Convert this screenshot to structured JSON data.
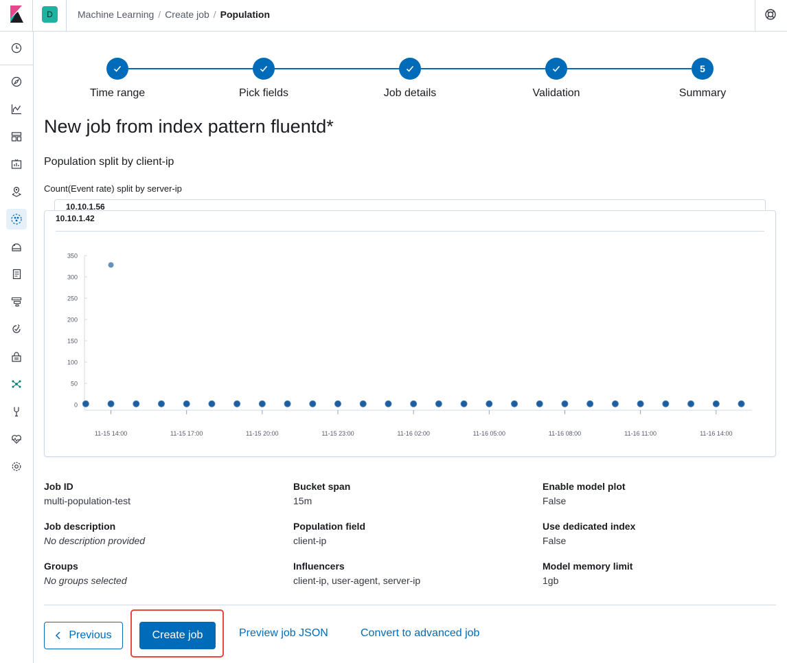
{
  "header": {
    "space_initial": "D",
    "breadcrumbs": [
      "Machine Learning",
      "Create job",
      "Population"
    ]
  },
  "sidebar": {
    "icons": [
      "clock-icon",
      "discover-icon",
      "visualize-icon",
      "dashboard-icon",
      "canvas-icon",
      "maps-icon",
      "machine-learning-icon",
      "infrastructure-icon",
      "logs-icon",
      "apm-icon",
      "uptime-icon",
      "siem-icon",
      "graph-icon",
      "dev-tools-icon",
      "monitoring-icon",
      "management-icon"
    ],
    "active": "machine-learning-icon"
  },
  "stepper": {
    "steps": [
      {
        "label": "Time range",
        "status": "complete"
      },
      {
        "label": "Pick fields",
        "status": "complete"
      },
      {
        "label": "Job details",
        "status": "complete"
      },
      {
        "label": "Validation",
        "status": "complete"
      },
      {
        "label": "Summary",
        "status": "current",
        "number": "5"
      }
    ]
  },
  "page_title": "New job from index pattern fluentd*",
  "population_title": "Population split by client-ip",
  "chart_title": "Count(Event rate) split by server-ip",
  "cards": {
    "back_label": "10.10.1.56",
    "front_label": "10.10.1.42"
  },
  "chart_data": {
    "type": "scatter",
    "x_tick_labels": [
      "11-15 14:00",
      "11-15 17:00",
      "11-15 20:00",
      "11-15 23:00",
      "11-16 02:00",
      "11-16 05:00",
      "11-16 08:00",
      "11-16 11:00",
      "11-16 14:00"
    ],
    "y_ticks": [
      0,
      50,
      100,
      150,
      200,
      250,
      300,
      350
    ],
    "ylim": [
      0,
      350
    ],
    "xlim_hours": [
      12.95,
      39.15
    ],
    "series": [
      {
        "color": "#6092c0",
        "points": [
          {
            "x_hours": 14,
            "y": 328
          }
        ]
      },
      {
        "color": "#1f5d9e",
        "points_at_hours": [
          13,
          14,
          15,
          16,
          17,
          18,
          19,
          20,
          21,
          22,
          23,
          24,
          25,
          26,
          27,
          28,
          29,
          30,
          31,
          32,
          33,
          34,
          35,
          36,
          37,
          38,
          39
        ],
        "y": 2
      }
    ],
    "grid": false
  },
  "details": {
    "col1": [
      {
        "key": "Job ID",
        "value": "multi-population-test",
        "italic": false
      },
      {
        "key": "Job description",
        "value": "No description provided",
        "italic": true
      },
      {
        "key": "Groups",
        "value": "No groups selected",
        "italic": true
      }
    ],
    "col2": [
      {
        "key": "Bucket span",
        "value": "15m"
      },
      {
        "key": "Population field",
        "value": "client-ip"
      },
      {
        "key": "Influencers",
        "value": "client-ip, user-agent, server-ip"
      }
    ],
    "col3": [
      {
        "key": "Enable model plot",
        "value": "False"
      },
      {
        "key": "Use dedicated index",
        "value": "False"
      },
      {
        "key": "Model memory limit",
        "value": "1gb"
      }
    ]
  },
  "actions": {
    "previous": "Previous",
    "create": "Create job",
    "preview": "Preview job JSON",
    "convert": "Convert to advanced job"
  },
  "colors": {
    "primary": "#006bb8",
    "highlight": "#e8473a"
  }
}
